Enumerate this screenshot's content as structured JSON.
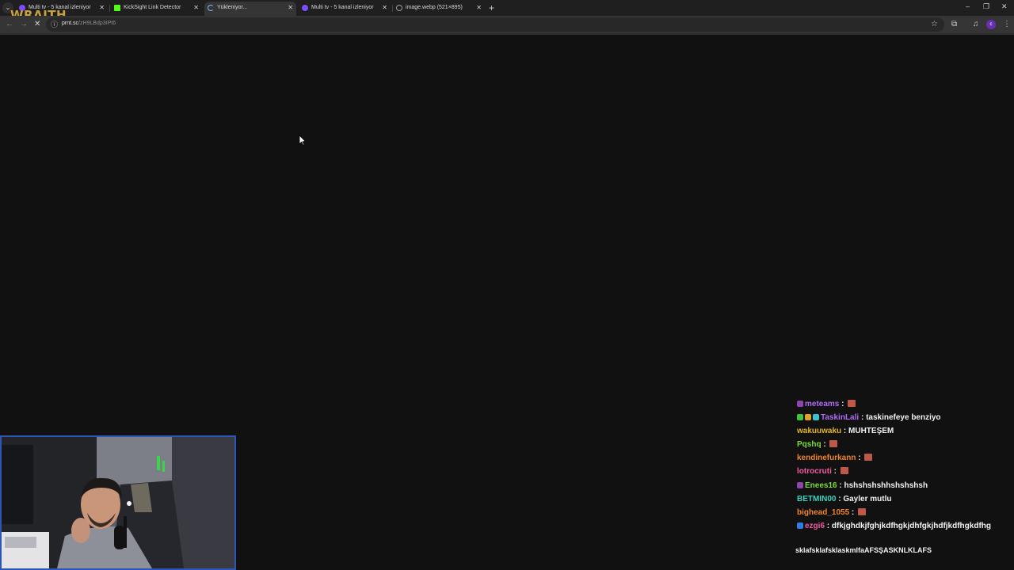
{
  "overlay": {
    "brand": "WRAITH"
  },
  "tabs": [
    {
      "label": "Multi tv - 5 kanal izleniyor",
      "favicon": "multitv-icon",
      "color": "#7c4dff",
      "active": false
    },
    {
      "label": "KickSight Link Detector",
      "favicon": "kick-icon",
      "color": "#53fc18",
      "active": false
    },
    {
      "label": "Yükleniyor...",
      "favicon": "loading-icon",
      "color": "#8ab4f8",
      "active": true
    },
    {
      "label": "Multi tv - 5 kanal izleniyor",
      "favicon": "multitv-icon",
      "color": "#7c4dff",
      "active": false
    },
    {
      "label": "image.webp (521×895)",
      "favicon": "globe-icon",
      "color": "#9e9e9e",
      "active": false
    }
  ],
  "toolbar": {
    "url_host": "prnt.sc",
    "url_path": "/zH9LBdp3IPt6",
    "profile_initial": "c"
  },
  "chat": [
    {
      "user": "meteams",
      "sep": " : ",
      "message": "",
      "user_color": "#b06cf5",
      "badges": [
        "#8e44ad"
      ],
      "emote": true
    },
    {
      "user": "TaskinLali",
      "sep": " : ",
      "message": "taskinefeye benziyo",
      "user_color": "#b06cf5",
      "badges": [
        "#3ec43e",
        "#e0a12a",
        "#39c1d6"
      ],
      "emote": false
    },
    {
      "user": "wakuuwaku",
      "sep": " : ",
      "message": "MUHTEŞEM",
      "user_color": "#e6b422",
      "badges": [],
      "emote": false
    },
    {
      "user": "Pqshq",
      "sep": " : ",
      "message": "",
      "user_color": "#7ddc3a",
      "badges": [],
      "emote": true
    },
    {
      "user": "kendinefurkann",
      "sep": " : ",
      "message": "",
      "user_color": "#f0842c",
      "badges": [],
      "emote": true
    },
    {
      "user": "lotrocruti",
      "sep": " : ",
      "message": "",
      "user_color": "#f25aa6",
      "badges": [],
      "emote": true
    },
    {
      "user": "Enees16",
      "sep": " : ",
      "message": "hshshshshhshshshsh",
      "user_color": "#7ddc3a",
      "badges": [
        "#8e44ad"
      ],
      "emote": false
    },
    {
      "user": "BETMIN00",
      "sep": " : ",
      "message": "Gayler mutlu",
      "user_color": "#3fd0c0",
      "badges": [],
      "emote": false
    },
    {
      "user": "bighead_1055",
      "sep": " : ",
      "message": "",
      "user_color": "#f0842c",
      "badges": [],
      "emote": true
    },
    {
      "user": "ezgi6",
      "sep": " : ",
      "message": "dfkjghdkjfghjkdfhgkjdhfgkjhdfjkdfhgkdfhg",
      "user_color": "#f25aa6",
      "badges": [
        "#2f7de1"
      ],
      "emote": false
    }
  ],
  "bottom_message": "sklafsklafsklaskmlfaAFSŞASKNLKLAFS",
  "colors": {
    "emote": "#c0584a",
    "webcam_border": "#2a56b8",
    "brand": "#c9a13a"
  }
}
